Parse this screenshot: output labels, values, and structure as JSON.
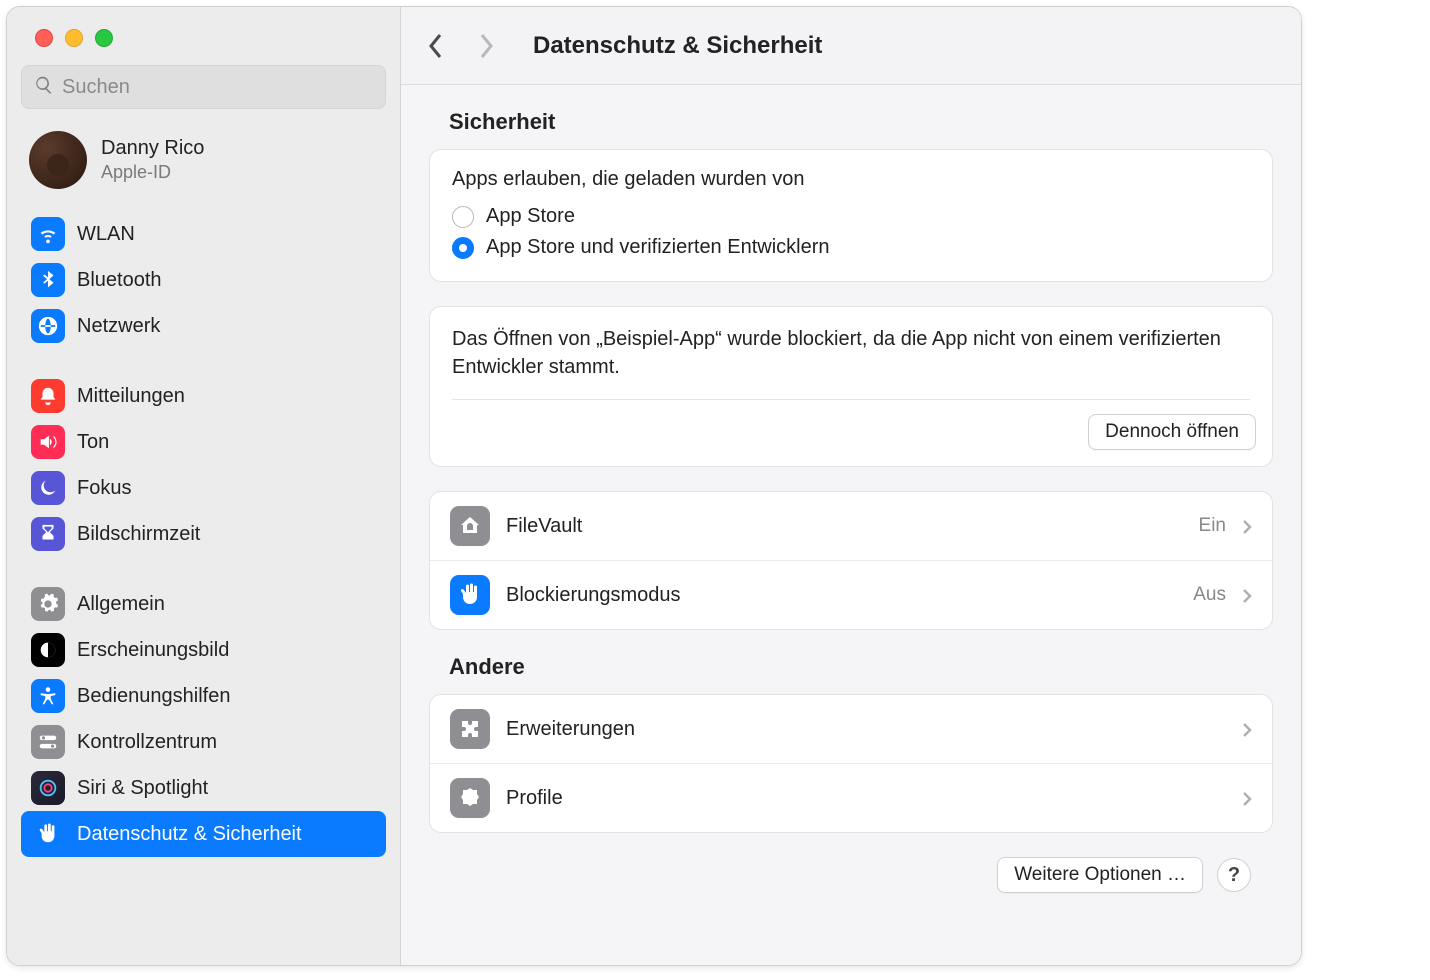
{
  "search": {
    "placeholder": "Suchen"
  },
  "user": {
    "name": "Danny Rico",
    "subtitle": "Apple-ID"
  },
  "sidebar": {
    "group1": [
      {
        "label": "WLAN",
        "color": "#0a7aff"
      },
      {
        "label": "Bluetooth",
        "color": "#0a7aff"
      },
      {
        "label": "Netzwerk",
        "color": "#0a7aff"
      }
    ],
    "group2": [
      {
        "label": "Mitteilungen",
        "color": "#ff3b30"
      },
      {
        "label": "Ton",
        "color": "#ff2d55"
      },
      {
        "label": "Fokus",
        "color": "#5856d6"
      },
      {
        "label": "Bildschirmzeit",
        "color": "#5856d6"
      }
    ],
    "group3": [
      {
        "label": "Allgemein",
        "color": "#8e8e93"
      },
      {
        "label": "Erscheinungsbild",
        "color": "#000000"
      },
      {
        "label": "Bedienungshilfen",
        "color": "#0a7aff"
      },
      {
        "label": "Kontrollzentrum",
        "color": "#8e8e93"
      },
      {
        "label": "Siri & Spotlight",
        "color": ""
      },
      {
        "label": "Datenschutz & Sicherheit",
        "color": "#0a7aff"
      }
    ]
  },
  "header": {
    "title": "Datenschutz & Sicherheit"
  },
  "main": {
    "security_heading": "Sicherheit",
    "allow_label": "Apps erlauben, die geladen wurden von",
    "radio1": "App Store",
    "radio2": "App Store und verifizierten Entwicklern",
    "blocked_message": "Das Öffnen von „Beispiel-App“ wurde blockiert, da die App nicht von einem verifizierten Entwickler stammt.",
    "open_anyway": "Dennoch öffnen",
    "rows": [
      {
        "label": "FileVault",
        "value": "Ein",
        "color": "#8e8e93"
      },
      {
        "label": "Blockierungsmodus",
        "value": "Aus",
        "color": "#0a7aff"
      }
    ],
    "other_heading": "Andere",
    "other_rows": [
      {
        "label": "Erweiterungen",
        "color": "#8e8e93"
      },
      {
        "label": "Profile",
        "color": "#8e8e93"
      }
    ],
    "more_options": "Weitere Optionen …",
    "help": "?"
  }
}
